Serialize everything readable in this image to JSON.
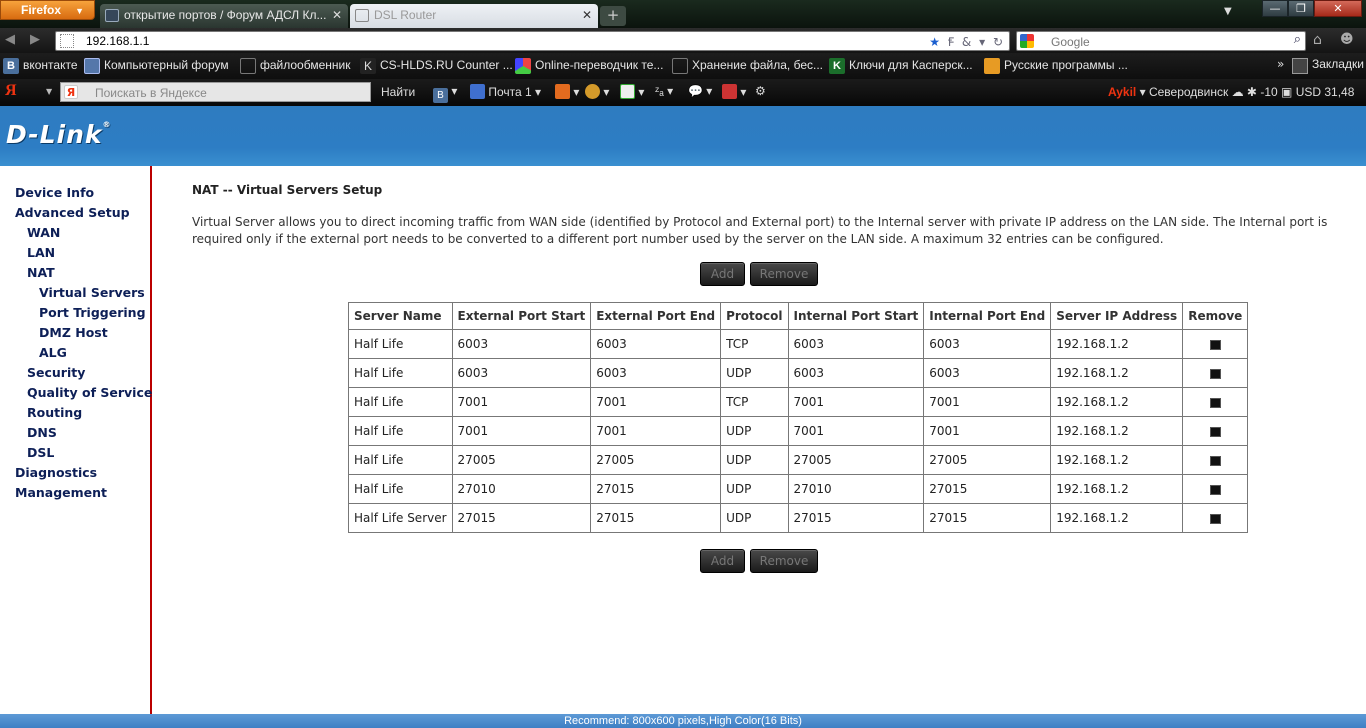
{
  "browser": {
    "menu_button": "Firefox",
    "tabs": [
      {
        "label": "открытие портов / Форум АДСЛ Кл..."
      },
      {
        "label": "DSL Router"
      }
    ],
    "url": "192.168.1.1",
    "search_placeholder": "Google",
    "bookmarks": [
      {
        "label": "вконтакте",
        "icon": "vk-icon"
      },
      {
        "label": "Компьютерный форум",
        "icon": "grid-icon"
      },
      {
        "label": "файлообменник",
        "icon": "page-icon"
      },
      {
        "label": "CS-HLDS.RU Counter ...",
        "icon": "cs-icon"
      },
      {
        "label": "Online-переводчик те...",
        "icon": "translate-icon"
      },
      {
        "label": "Хранение файла, бес...",
        "icon": "page-icon"
      },
      {
        "label": "Ключи для Касперск...",
        "icon": "kaspersky-icon"
      },
      {
        "label": "Русские программы ...",
        "icon": "programs-icon"
      }
    ],
    "bookmarks_more": "»",
    "bookmarks_menu": "Закладки",
    "yandex": {
      "logo": "Я",
      "search_placeholder": "Поискать в Яндексе",
      "find_label": "Найти",
      "mail_label": "Почта 1",
      "user": "Aykil",
      "city": "Северодвинск",
      "temperature": "-10",
      "currency": "USD 31,48"
    }
  },
  "router": {
    "logo": "D-Link",
    "menu": [
      {
        "label": "Device Info",
        "level": 0
      },
      {
        "label": "Advanced Setup",
        "level": 0
      },
      {
        "label": "WAN",
        "level": 1
      },
      {
        "label": "LAN",
        "level": 1
      },
      {
        "label": "NAT",
        "level": 1
      },
      {
        "label": "Virtual Servers",
        "level": 2
      },
      {
        "label": "Port Triggering",
        "level": 2
      },
      {
        "label": "DMZ Host",
        "level": 2
      },
      {
        "label": "ALG",
        "level": 2
      },
      {
        "label": "Security",
        "level": 1
      },
      {
        "label": "Quality of Service",
        "level": 1
      },
      {
        "label": "Routing",
        "level": 1
      },
      {
        "label": "DNS",
        "level": 1
      },
      {
        "label": "DSL",
        "level": 1
      },
      {
        "label": "Diagnostics",
        "level": 0
      },
      {
        "label": "Management",
        "level": 0
      }
    ],
    "title": "NAT -- Virtual Servers Setup",
    "description": "Virtual Server allows you to direct incoming traffic from WAN side (identified by Protocol and External port) to the Internal server with private IP address on the LAN side. The Internal port is required only if the external port needs to be converted to a different port number used by the server on the LAN side. A maximum 32 entries can be configured.",
    "buttons": {
      "add": "Add",
      "remove": "Remove"
    },
    "table": {
      "headers": [
        "Server Name",
        "External Port Start",
        "External Port End",
        "Protocol",
        "Internal Port Start",
        "Internal Port End",
        "Server IP Address",
        "Remove"
      ],
      "rows": [
        [
          "Half Life",
          "6003",
          "6003",
          "TCP",
          "6003",
          "6003",
          "192.168.1.2"
        ],
        [
          "Half Life",
          "6003",
          "6003",
          "UDP",
          "6003",
          "6003",
          "192.168.1.2"
        ],
        [
          "Half Life",
          "7001",
          "7001",
          "TCP",
          "7001",
          "7001",
          "192.168.1.2"
        ],
        [
          "Half Life",
          "7001",
          "7001",
          "UDP",
          "7001",
          "7001",
          "192.168.1.2"
        ],
        [
          "Half Life",
          "27005",
          "27005",
          "UDP",
          "27005",
          "27005",
          "192.168.1.2"
        ],
        [
          "Half Life",
          "27010",
          "27015",
          "UDP",
          "27010",
          "27015",
          "192.168.1.2"
        ],
        [
          "Half Life Server",
          "27015",
          "27015",
          "UDP",
          "27015",
          "27015",
          "192.168.1.2"
        ]
      ]
    },
    "footer": "Recommend: 800x600 pixels,High Color(16 Bits)"
  }
}
